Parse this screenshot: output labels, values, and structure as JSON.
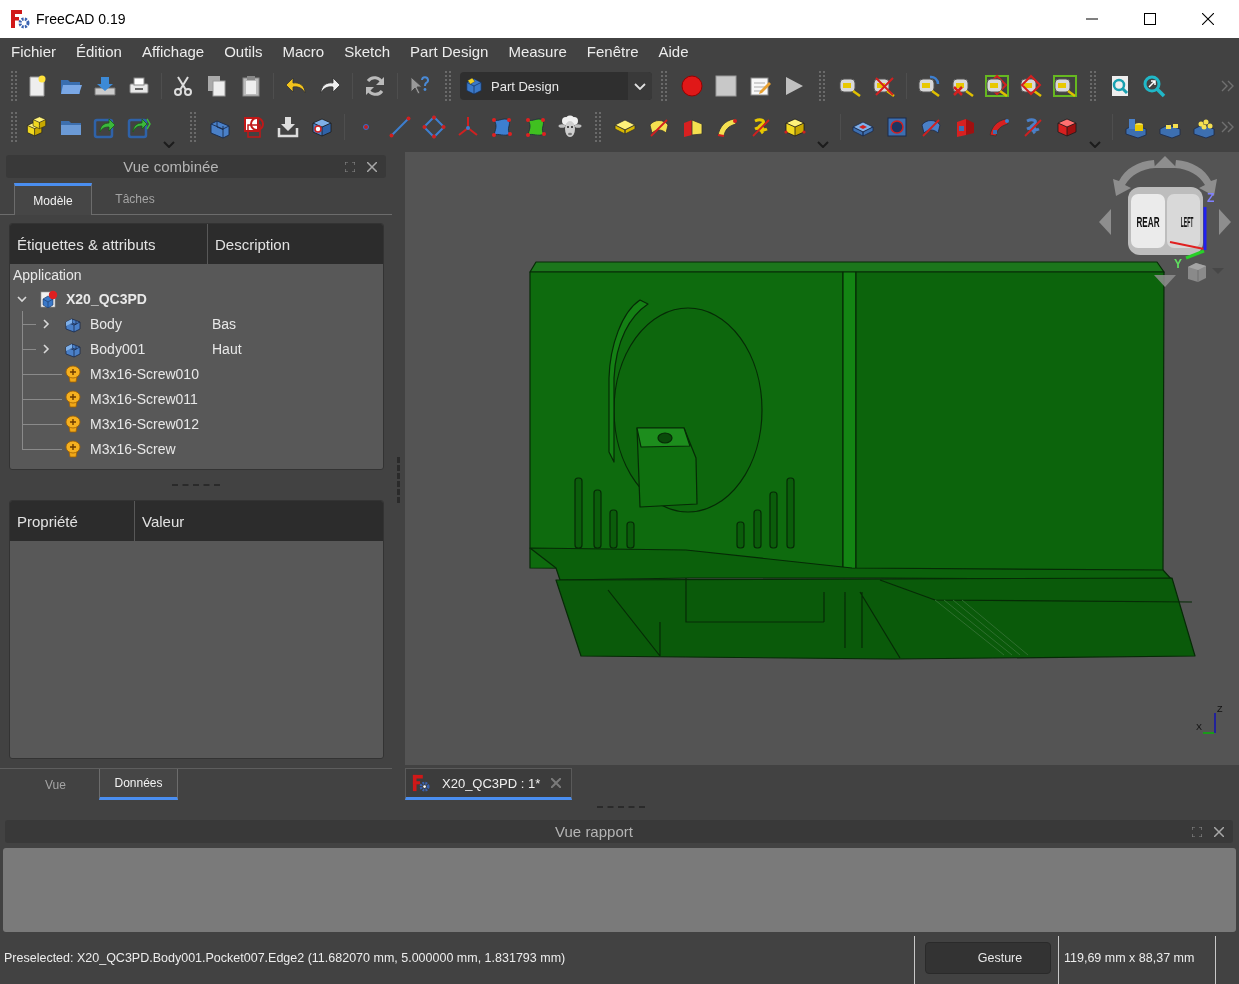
{
  "window": {
    "title": "FreeCAD 0.19"
  },
  "menu": [
    "Fichier",
    "Édition",
    "Affichage",
    "Outils",
    "Macro",
    "Sketch",
    "Part Design",
    "Measure",
    "Fenêtre",
    "Aide"
  ],
  "workbench_selector": {
    "value": "Part Design"
  },
  "combo_view": {
    "title": "Vue combinée",
    "tabs": [
      {
        "label": "Modèle",
        "selected": true
      },
      {
        "label": "Tâches",
        "selected": false
      }
    ],
    "tree": {
      "columns": [
        "Étiquettes & attributs",
        "Description"
      ],
      "items": [
        {
          "label": "Application",
          "children": [
            {
              "label": "X20_QC3PD",
              "kind": "document",
              "expanded": true,
              "children": [
                {
                  "label": "Body",
                  "description": "Bas",
                  "kind": "body",
                  "expanded": false
                },
                {
                  "label": "Body001",
                  "description": "Haut",
                  "kind": "body",
                  "expanded": false
                },
                {
                  "label": "M3x16-Screw010",
                  "kind": "screw"
                },
                {
                  "label": "M3x16-Screw011",
                  "kind": "screw"
                },
                {
                  "label": "M3x16-Screw012",
                  "kind": "screw"
                },
                {
                  "label": "M3x16-Screw",
                  "kind": "screw"
                }
              ]
            }
          ]
        }
      ]
    },
    "properties": {
      "columns": [
        "Propriété",
        "Valeur"
      ]
    },
    "bottom_tabs": [
      {
        "label": "Vue",
        "selected": false
      },
      {
        "label": "Données",
        "selected": true
      }
    ]
  },
  "viewport": {
    "nav_cube": {
      "faces": [
        "REAR",
        "LEFT"
      ],
      "axes": [
        "Z",
        "Y"
      ]
    },
    "corner_axes": [
      "Z",
      "X"
    ]
  },
  "document_tabs": [
    {
      "label": "X20_QC3PD : 1*",
      "selected": true
    }
  ],
  "report_view": {
    "title": "Vue rapport"
  },
  "status_bar": {
    "message": "Preselected: X20_QC3PD.Body001.Pocket007.Edge2 (11.682070 mm, 5.000000 mm, 1.831793 mm)",
    "navigation_style": "Gesture",
    "dimensions": "119,69 mm x 88,37 mm"
  }
}
